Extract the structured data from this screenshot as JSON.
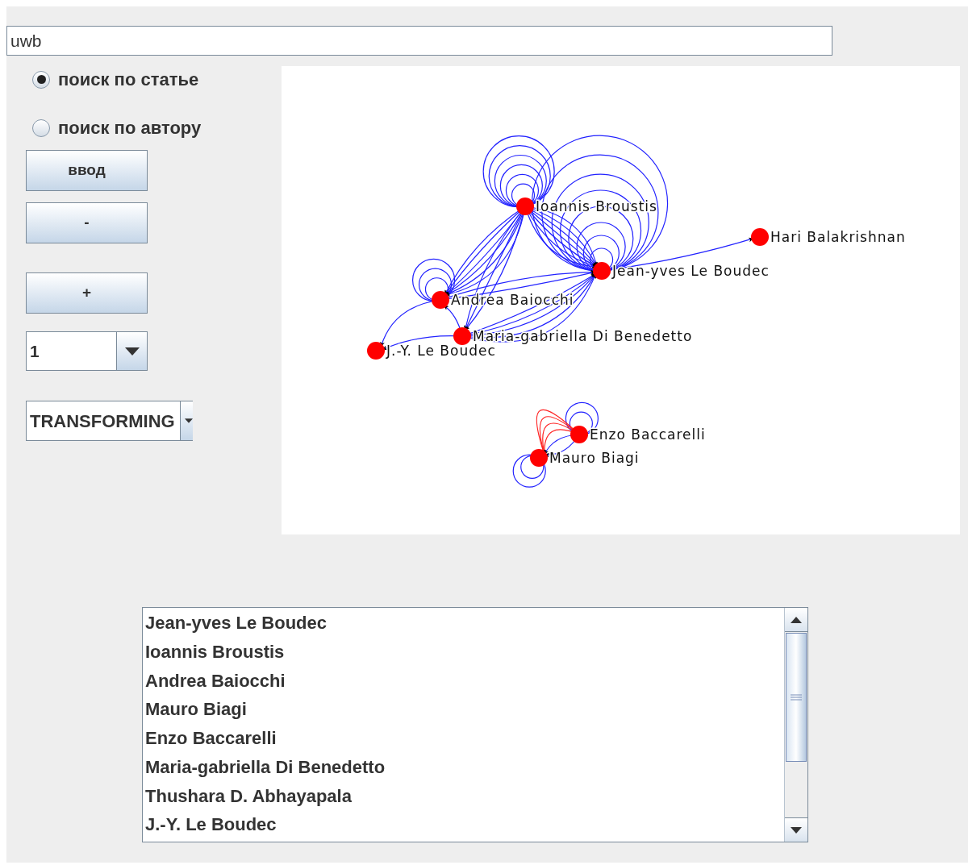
{
  "search": {
    "value": "uwb"
  },
  "search_mode": [
    {
      "label": "поиск по статье",
      "selected": true
    },
    {
      "label": "поиск по автору",
      "selected": false
    }
  ],
  "buttons": [
    "ввод",
    "-",
    "+"
  ],
  "depth_combo": {
    "value": "1"
  },
  "mode_combo": {
    "value": "TRANSFORMING"
  },
  "graph": {
    "nodes": [
      {
        "label": "Ioannis Broustis"
      },
      {
        "label": "Hari Balakrishnan"
      },
      {
        "label": "Jean-yves Le Boudec"
      },
      {
        "label": "Andrea Baiocchi"
      },
      {
        "label": "Maria-gabriella Di Benedetto"
      },
      {
        "label": "J.-Y. Le Boudec"
      },
      {
        "label": "Enzo Baccarelli"
      },
      {
        "label": "Mauro Biagi"
      }
    ]
  },
  "author_list": [
    "Jean-yves Le Boudec",
    "Ioannis Broustis",
    "Andrea Baiocchi",
    "Mauro Biagi",
    "Enzo Baccarelli",
    "Maria-gabriella Di Benedetto",
    "Thushara D. Abhayapala",
    "J.-Y. Le Boudec"
  ]
}
